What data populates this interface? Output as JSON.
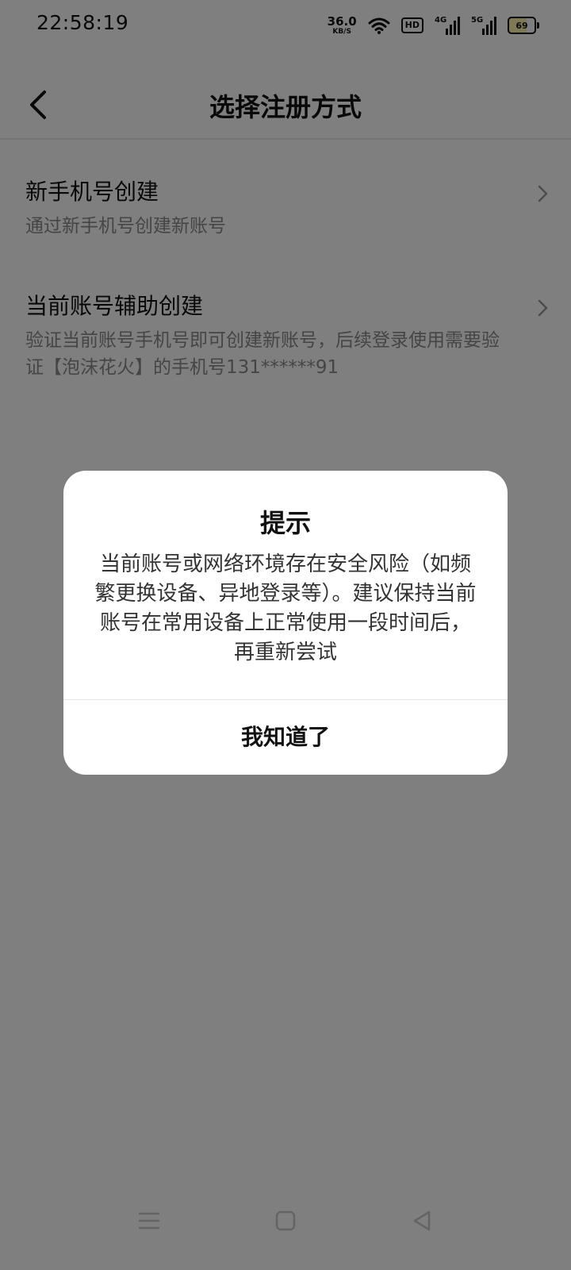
{
  "status_bar": {
    "time": "22:58:19",
    "net_speed_value": "36.0",
    "net_speed_unit": "KB/S",
    "hd_label": "HD",
    "sim1_label": "4G",
    "sim2_label": "5G",
    "battery": "69"
  },
  "header": {
    "title": "选择注册方式"
  },
  "options": [
    {
      "title": "新手机号创建",
      "desc": "通过新手机号创建新账号"
    },
    {
      "title": "当前账号辅助创建",
      "desc": "验证当前账号手机号即可创建新账号，后续登录使用需要验证【泡沫花火】的手机号131******91"
    }
  ],
  "dialog": {
    "title": "提示",
    "message": "当前账号或网络环境存在安全风险（如频繁更换设备、异地登录等）。建议保持当前账号在常用设备上正常使用一段时间后，再重新尝试",
    "confirm_label": "我知道了"
  },
  "icons": {
    "back": "chevron-left-icon",
    "option_arrow": "chevron-right-icon",
    "nav_menu": "menu-icon",
    "nav_home": "home-square-icon",
    "nav_back": "back-triangle-icon"
  },
  "colors": {
    "overlay": "rgba(0,0,0,0.5)",
    "battery_fill": "#fdf0a8"
  }
}
